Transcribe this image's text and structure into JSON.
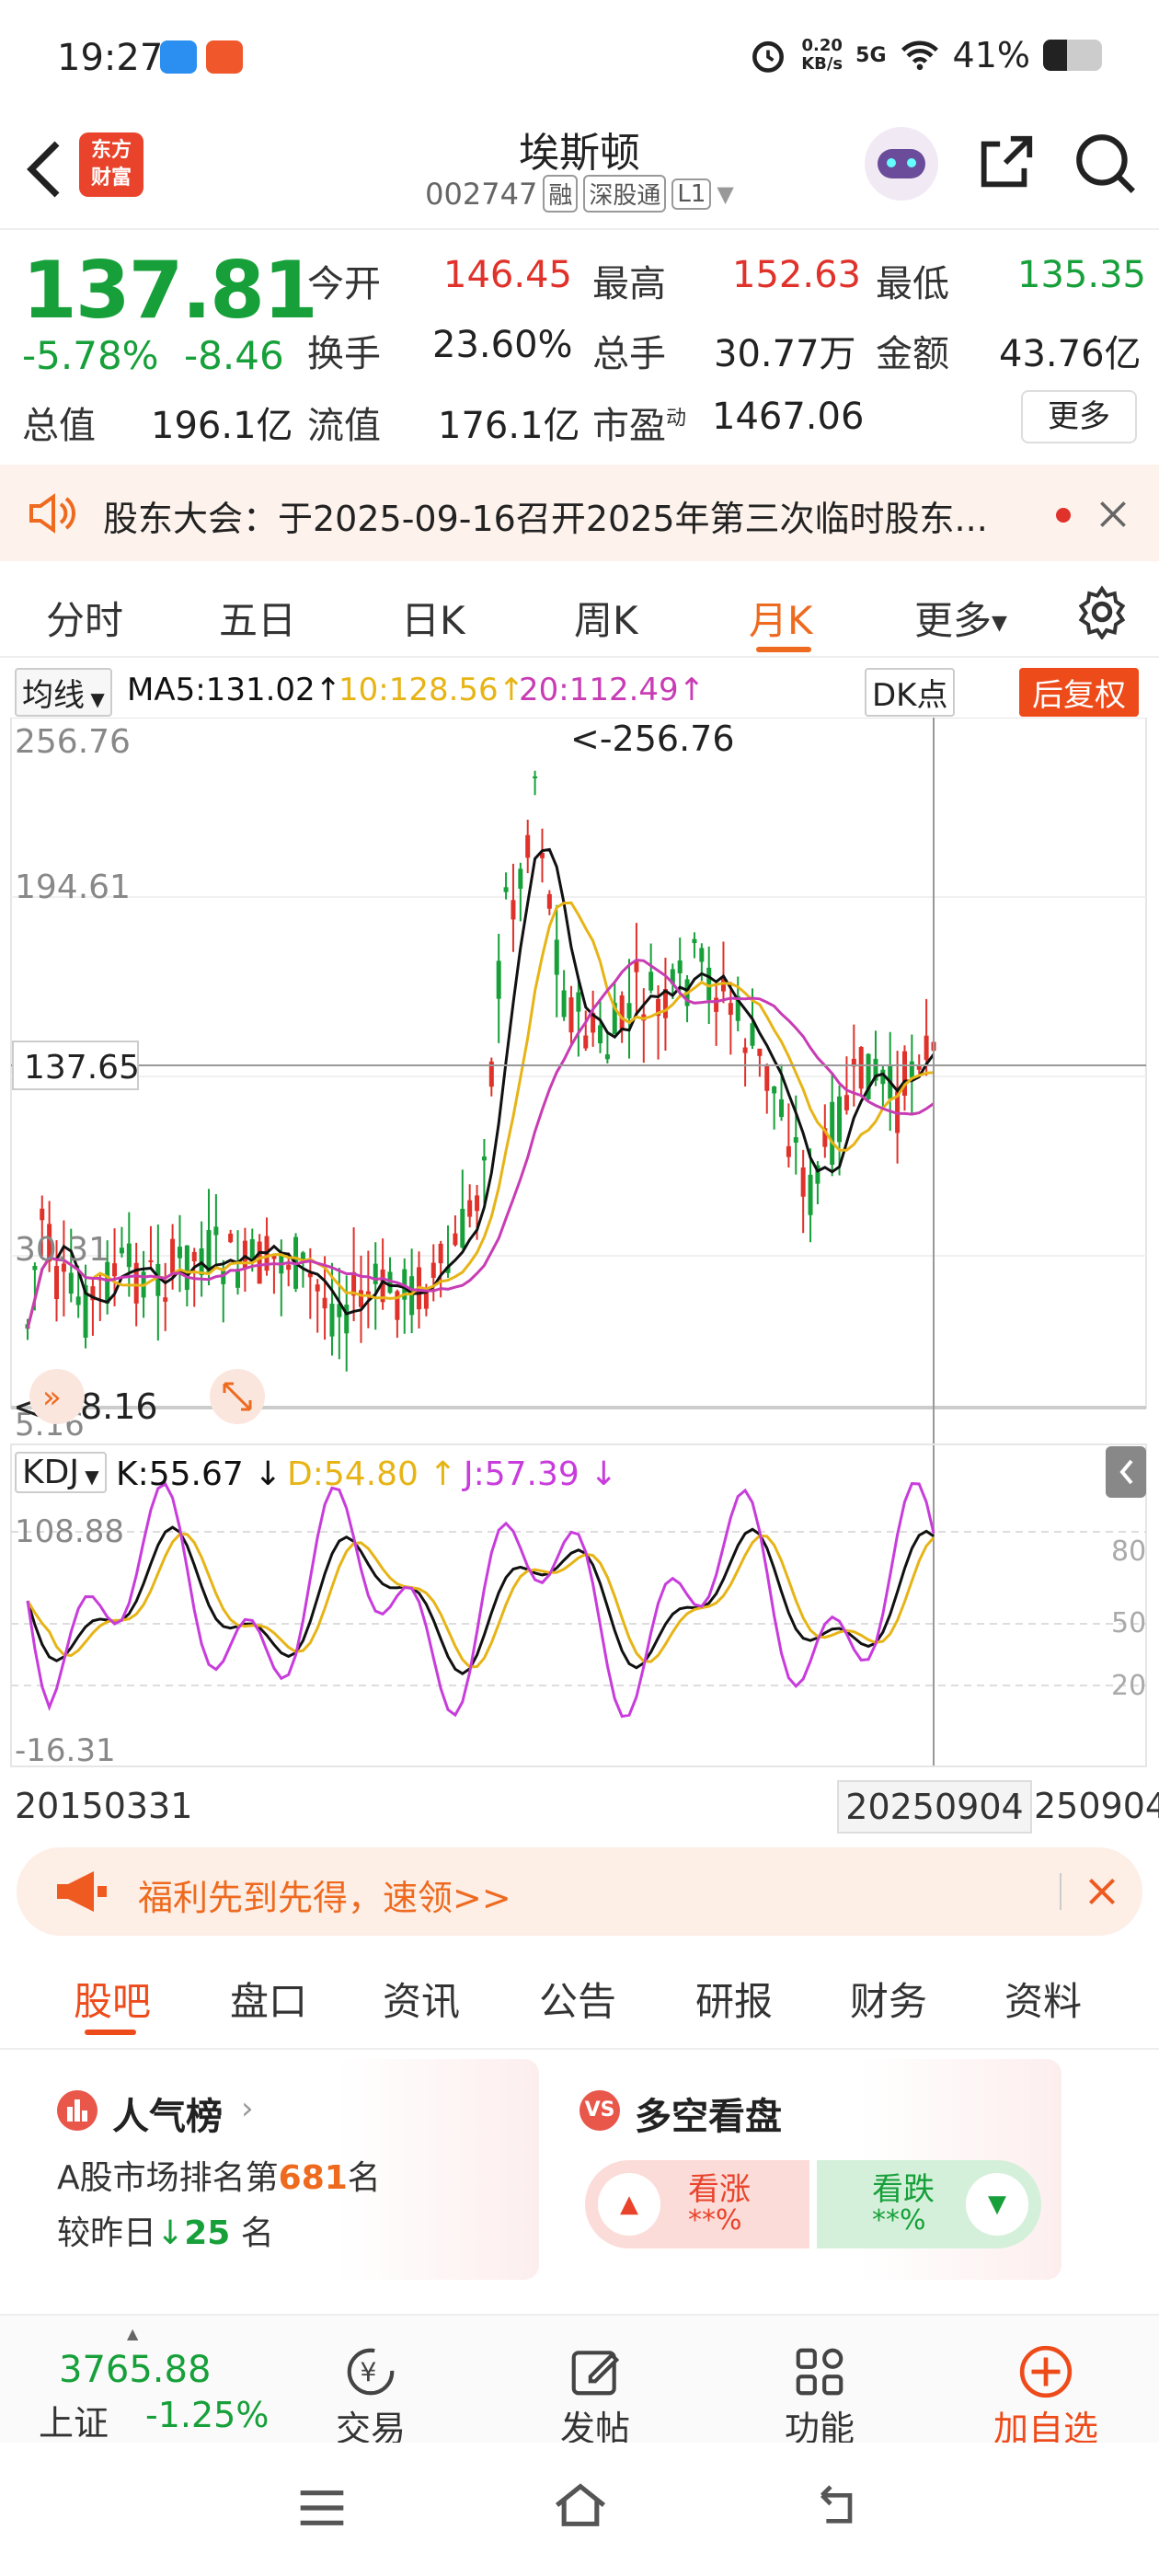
{
  "status": {
    "time": "19:27",
    "net_speed_top": "0.20",
    "net_speed_bottom": "KB/s",
    "network": "5G",
    "battery": "41%"
  },
  "header": {
    "logo_line1": "东方",
    "logo_line2": "财富",
    "name": "埃斯顿",
    "code": "002747",
    "tag1": "融",
    "tag2": "深股通",
    "tag3": "L1"
  },
  "quote": {
    "price": "137.81",
    "pct": "-5.78%",
    "change": "-8.46",
    "open_label": "今开",
    "open": "146.45",
    "high_label": "最高",
    "high": "152.63",
    "low_label": "最低",
    "low": "135.35",
    "turnover_label": "换手",
    "turnover": "23.60%",
    "volume_label": "总手",
    "volume": "30.77万",
    "amount_label": "金额",
    "amount": "43.76亿",
    "mktcap_label": "总值",
    "mktcap": "196.1亿",
    "float_label": "流值",
    "float": "176.1亿",
    "pe_label": "市盈",
    "pe_sup": "动",
    "pe": "1467.06",
    "more_label": "更多"
  },
  "notice": {
    "text": "股东大会：于2025-09-16召开2025年第三次临时股东..."
  },
  "period_tabs": [
    "分时",
    "五日",
    "日K",
    "周K",
    "月K",
    "更多"
  ],
  "period_active": "月K",
  "ma": {
    "selector": "均线",
    "ma5": "MA5:131.02",
    "ma10": "10:128.56",
    "ma20": "20:112.49",
    "dk": "DK点",
    "fuquan": "后复权",
    "color_ma5": "#111111",
    "color_ma10": "#e7b416",
    "color_ma20": "#c83cb4"
  },
  "kdj": {
    "selector": "KDJ",
    "k": "K:55.67",
    "d": "D:54.80",
    "j": "J:57.39",
    "color_k": "#111111",
    "color_d": "#e7b416",
    "color_j": "#c83cdc"
  },
  "chart_data": {
    "type": "candlestick",
    "y_ticks": [
      "256.76",
      "194.61",
      "30.31",
      "5.16"
    ],
    "max_label": "<-256.76",
    "min_label": "<---8.16",
    "crosshair_price": "137.65",
    "kdj_ticks": [
      "108.88",
      "-16.31"
    ],
    "kdj_right_ticks": [
      "80",
      "50",
      "20"
    ],
    "x_start": "20150331",
    "x_end": "20250904",
    "x_end_partial": "250904",
    "price_range": [
      5.16,
      256.76
    ],
    "kdj_range": [
      -16.31,
      108.88
    ]
  },
  "promo": {
    "text": "福利先到先得，速领>>"
  },
  "content_tabs": [
    "股吧",
    "盘口",
    "资讯",
    "公告",
    "研报",
    "财务",
    "资料"
  ],
  "content_active": "股吧",
  "popular": {
    "title": "人气榜",
    "rank_prefix": "A股市场排名第",
    "rank": "681",
    "rank_suffix": "名",
    "change_prefix": "较昨日",
    "change": "25",
    "change_suffix": "名"
  },
  "bullbear": {
    "title": "多空看盘",
    "up_label": "看涨",
    "up_value": "**%",
    "down_label": "看跌",
    "down_value": "**%"
  },
  "bottom_nav": {
    "index_value": "3765.88",
    "index_name": "上证",
    "index_change": "-1.25%",
    "trade": "交易",
    "post": "发帖",
    "function": "功能",
    "add": "加自选"
  }
}
